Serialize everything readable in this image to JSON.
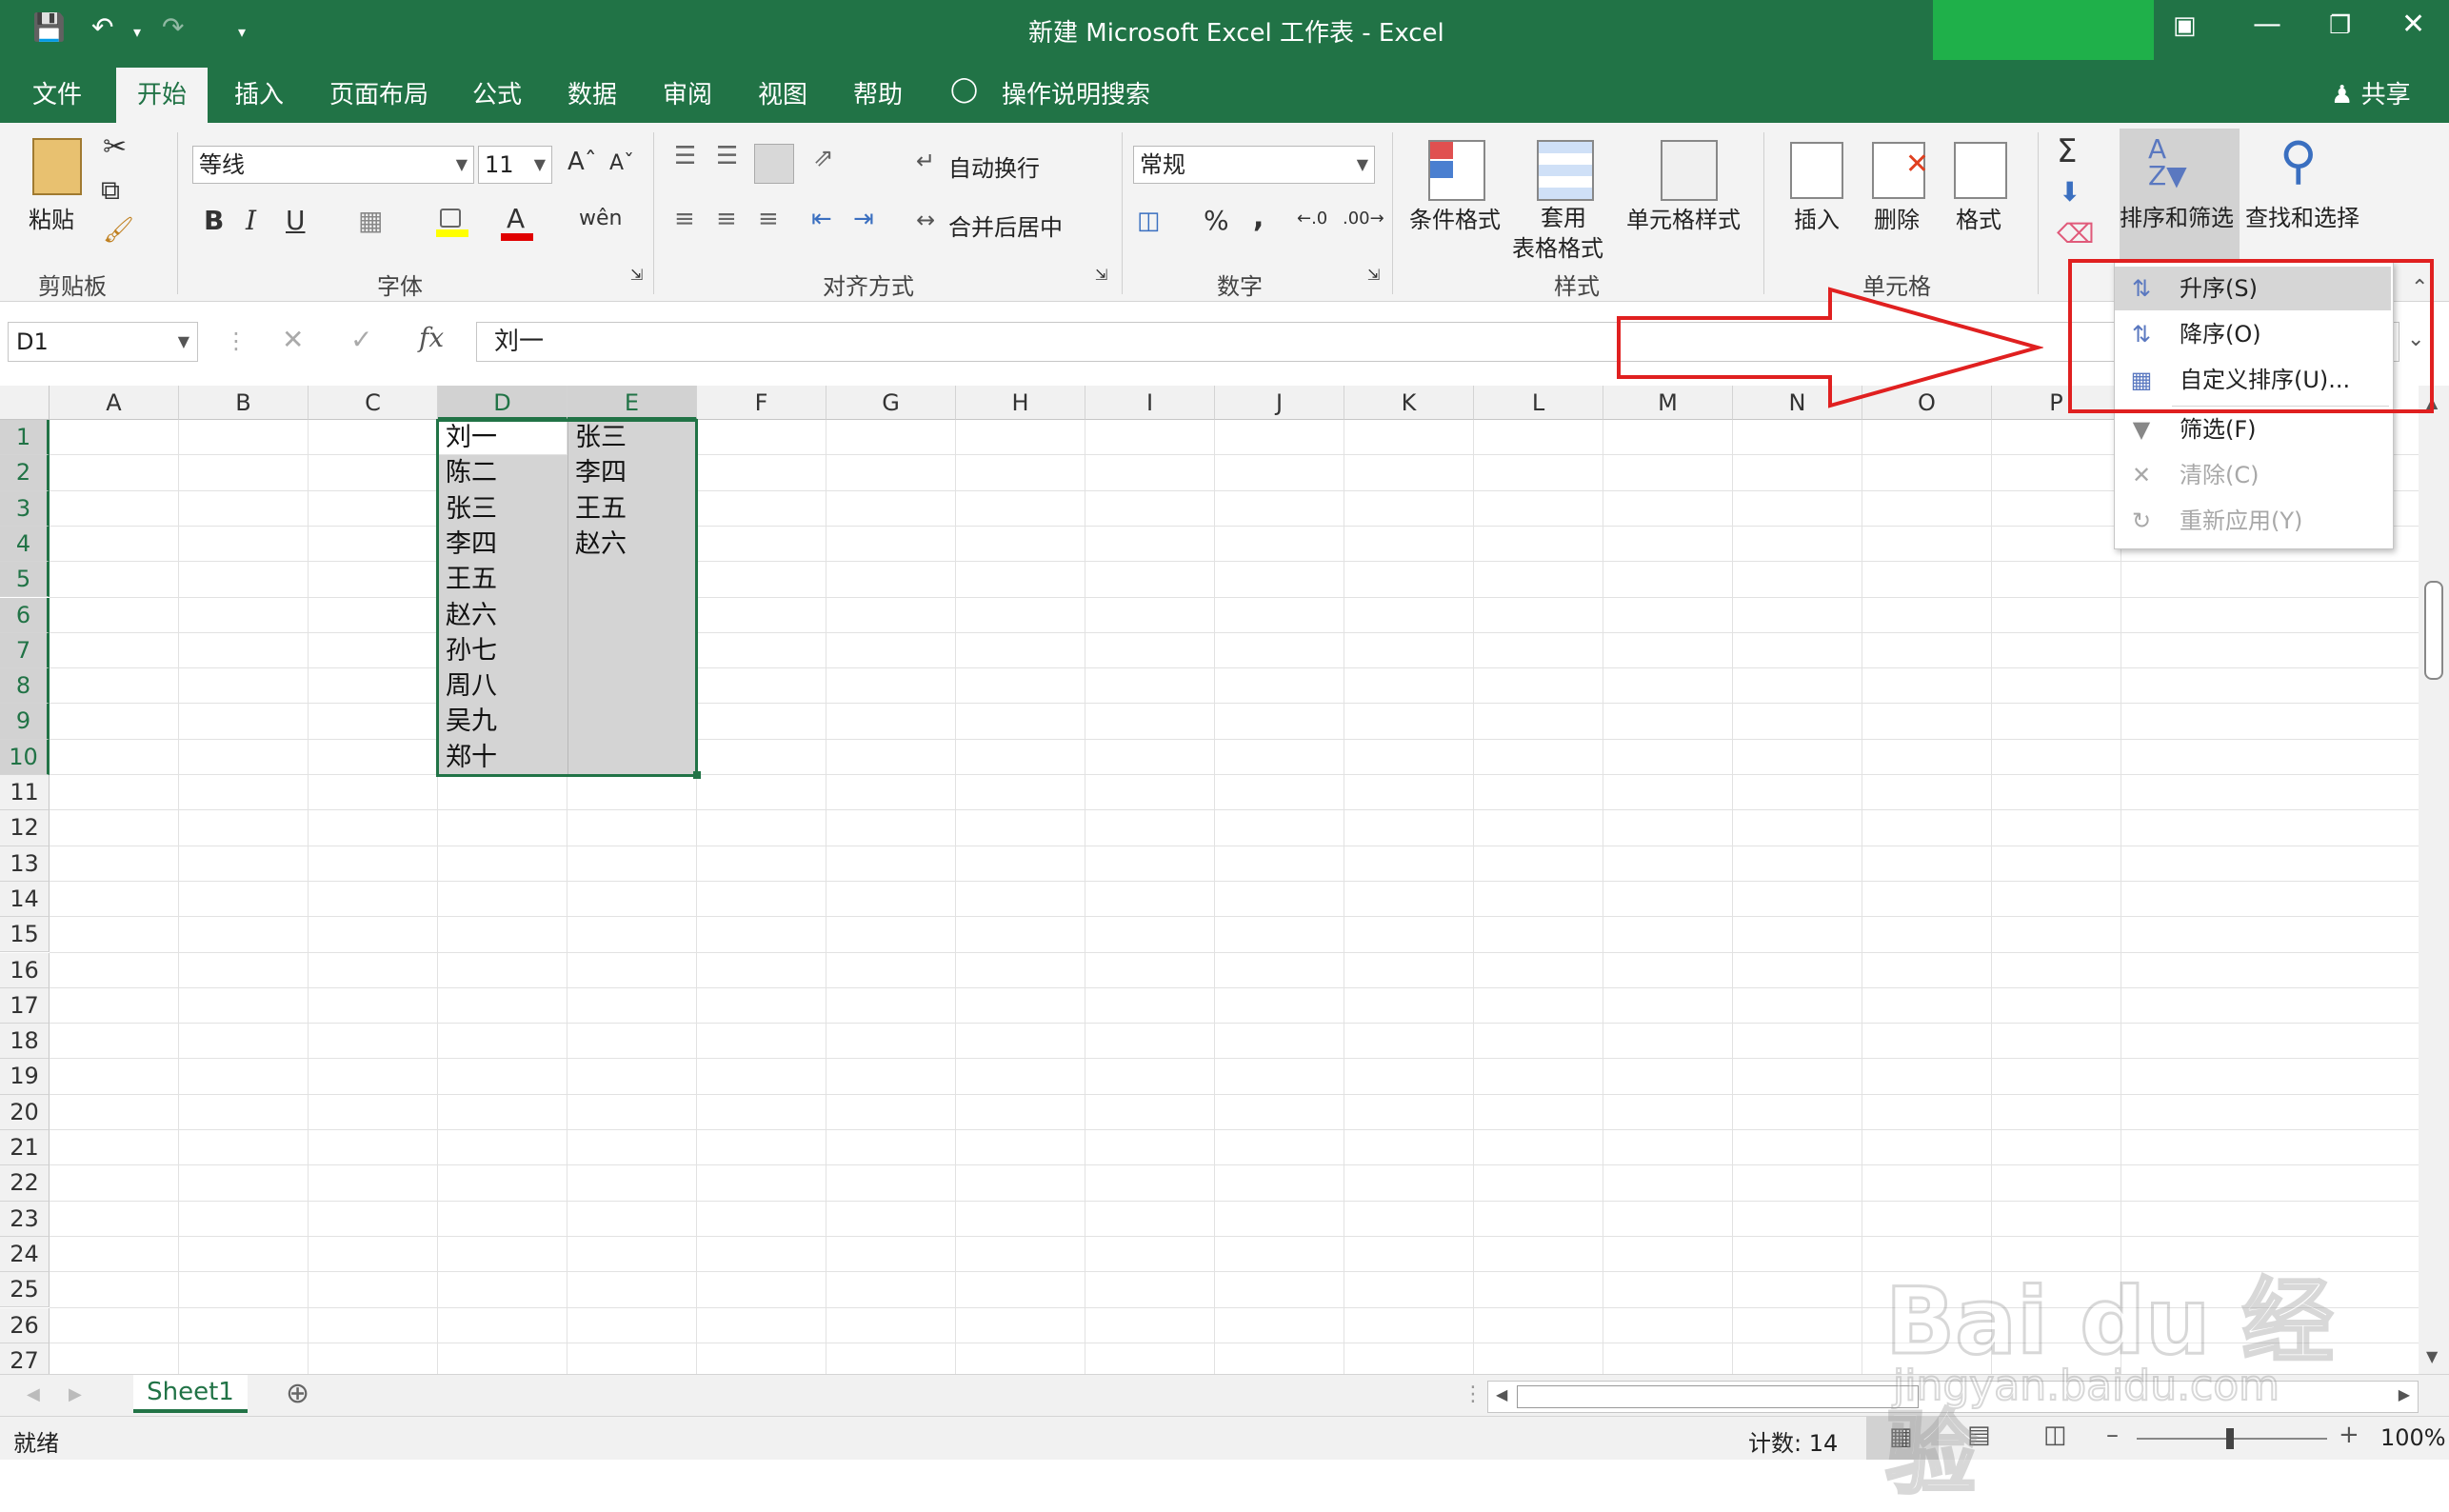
{
  "window": {
    "title": "新建 Microsoft Excel 工作表  -  Excel"
  },
  "tabs": [
    "文件",
    "开始",
    "插入",
    "页面布局",
    "公式",
    "数据",
    "审阅",
    "视图",
    "帮助"
  ],
  "tell_me": "操作说明搜索",
  "share": "共享",
  "ribbon": {
    "clipboard": {
      "paste": "粘贴",
      "label": "剪贴板"
    },
    "font": {
      "name": "等线",
      "size": "11",
      "label": "字体",
      "bold": "B",
      "italic": "I",
      "underline": "U"
    },
    "alignment": {
      "wrap": "自动换行",
      "merge": "合并后居中",
      "label": "对齐方式"
    },
    "number": {
      "format": "常规",
      "label": "数字",
      "percent": "%",
      "comma": ","
    },
    "styles": {
      "conditional": "条件格式",
      "table_line1": "套用",
      "table_line2": "表格格式",
      "cell_styles": "单元格样式",
      "label": "样式"
    },
    "cells": {
      "insert": "插入",
      "delete": "删除",
      "format": "格式",
      "label": "单元格"
    },
    "editing": {
      "sort_filter": "排序和筛选",
      "find_select": "查找和选择"
    }
  },
  "formula_bar": {
    "name_box": "D1",
    "content": "刘一",
    "fx": "fx"
  },
  "columns": [
    "A",
    "B",
    "C",
    "D",
    "E",
    "F",
    "G",
    "H",
    "I",
    "J",
    "K",
    "L",
    "M",
    "N",
    "O",
    "P"
  ],
  "rows": [
    "1",
    "2",
    "3",
    "4",
    "5",
    "6",
    "7",
    "8",
    "9",
    "10",
    "11",
    "12",
    "13",
    "14",
    "15",
    "16",
    "17",
    "18",
    "19",
    "20",
    "21",
    "22",
    "23",
    "24",
    "25",
    "26",
    "27"
  ],
  "cells": {
    "D": [
      "刘一",
      "陈二",
      "张三",
      "李四",
      "王五",
      "赵六",
      "孙七",
      "周八",
      "吴九",
      "郑十"
    ],
    "E": [
      "张三",
      "李四",
      "王五",
      "赵六"
    ]
  },
  "dropdown": [
    {
      "label": "升序(S)",
      "icon": "sort-asc-icon"
    },
    {
      "label": "降序(O)",
      "icon": "sort-desc-icon"
    },
    {
      "label": "自定义排序(U)...",
      "icon": "custom-sort-icon"
    },
    {
      "label": "筛选(F)",
      "icon": "filter-icon"
    },
    {
      "label": "清除(C)",
      "icon": "clear-filter-icon"
    },
    {
      "label": "重新应用(Y)",
      "icon": "reapply-icon"
    }
  ],
  "sheet": {
    "name": "Sheet1"
  },
  "status": {
    "ready": "就绪",
    "count": "计数: 14",
    "zoom": "100%"
  },
  "watermark": {
    "brand": "Bai du 经验",
    "url": "jingyan.baidu.com"
  },
  "colors": {
    "excel_green": "#217346",
    "highlight_red": "#e02020"
  }
}
